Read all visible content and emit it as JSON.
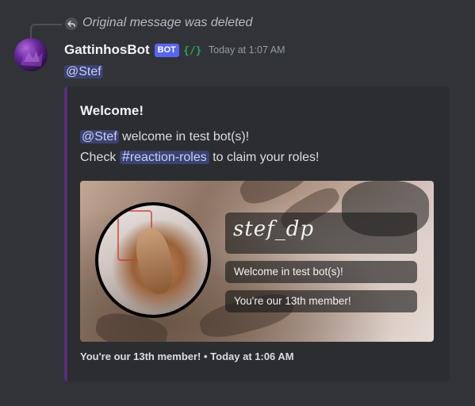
{
  "reply": {
    "text": "Original message was deleted",
    "icon": "reply-arrow-icon"
  },
  "author": {
    "name": "GattinhosBot",
    "bot_tag": "BOT",
    "slash_icon": "{/}",
    "timestamp": "Today at 1:07 AM",
    "avatar_icon": "purple-cat-avatar"
  },
  "message": {
    "mention": "@Stef"
  },
  "embed": {
    "accent_color": "#5b2b7a",
    "title": "Welcome!",
    "mention": "@Stef",
    "line1_rest": " welcome in test bot(s)!",
    "line2_prefix": "Check ",
    "channel_hash": "#",
    "channel_name": "reaction-roles",
    "line2_suffix": " to claim your roles!",
    "footer": "You're our 13th member! • Today at 1:06 AM",
    "image": {
      "name_banner": "stef_dp",
      "welcome_banner": "Welcome in test bot(s)!",
      "count_banner": "You're our 13th member!"
    }
  },
  "colors": {
    "background": "#313338",
    "mention_bg": "#3c4270",
    "mention_fg": "#c9cdfb",
    "bot_tag": "#5865f2",
    "slash_green": "#23a55a"
  }
}
